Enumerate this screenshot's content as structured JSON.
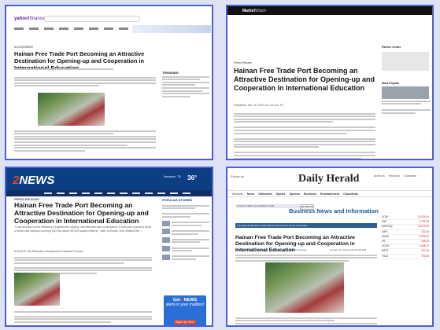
{
  "panel_yahoo": {
    "logo": "yahoo!",
    "logo_suffix": "finance",
    "kicker": "ACCESSWIRE",
    "title": "Hainan Free Trade Port Becoming an Attractive Destination for Opening-up and Cooperation in International Education",
    "trending_heading": "TRENDING"
  },
  "panel_marketwatch": {
    "logo": "Market",
    "logo_suffix": "Watch",
    "kicker": "Press Release",
    "title": "Hainan Free Trade Port Becoming an Attractive Destination for Opening-up and Cooperation in International Education",
    "meta": "Published: Jan. 29, 2021 at 1:43 a.m. ET",
    "side_heading": "Partner Center",
    "side_heading2": "Most Popular"
  },
  "panel_kprc": {
    "logo_num": "2",
    "logo_word": "NEWS",
    "city": "Houston, TX",
    "temp": "36°",
    "kicker": "PRESS RELEASE",
    "title": "Hainan Free Trade Port Becoming an Attractive Destination for Opening-up and Cooperation in International Education",
    "body": "\"I was shocked at the efficiency of agreement signing, site selection and construction. It took just 3 years to build a brand new campus covering 140 mu (about 90,000 square meters),\" said Jo Evans. She recalled the...",
    "source": "SOURCE The Education Department of Hainan Province",
    "popular": "POPULAR STORIES",
    "ad_line1_pre": "Get",
    "ad_line1_num": "2",
    "ad_line1_word": "NEWS",
    "ad_line2": "alerts in your mailbox!",
    "ad_button": "Sign Up Here"
  },
  "panel_dailyherald": {
    "logo": "Daily Herald",
    "top_left": "Follow us",
    "top_right": [
      "Archives",
      "Help/Info",
      "Subscribe"
    ],
    "nav": [
      "Sections",
      "News",
      "Obituaries",
      "Sports",
      "Opinion",
      "Business",
      "Entertainment",
      "Classifieds"
    ],
    "subbar": "TICKER SYMBOL OR COMPANY NAME",
    "getquote": "GET QUOTE",
    "section_title": "Business News and Information",
    "tabs": "The Daily Herald Market Index   Markets   Stock Screen   Funds   Tools   ETFs",
    "title": "Hainan Free Trade Port Becoming an Attractive Destination for Opening-up and Cooperation in International Education",
    "byline": "By: The Education Department of Hainan Province via PR Newswire",
    "date": "January 29, 2021 at 01:32 AM EST",
    "quotes": [
      {
        "name": "DOW",
        "value": "31,024.91",
        "dir": "down"
      },
      {
        "name": "S&P",
        "value": "3,742.63",
        "dir": "down"
      },
      {
        "name": "NASDAQ",
        "value": "13,070.69",
        "dir": "down"
      },
      {
        "name": "AAPL",
        "value": "131.96",
        "dir": "down"
      },
      {
        "name": "AMZN",
        "value": "3,206.20",
        "dir": "down"
      },
      {
        "name": "FB",
        "value": "258.33",
        "dir": "down"
      },
      {
        "name": "GOOG",
        "value": "1,835.74",
        "dir": "down"
      },
      {
        "name": "MSFT",
        "value": "231.96",
        "dir": "down"
      },
      {
        "name": "TSLA",
        "value": "793.53",
        "dir": "down"
      }
    ]
  }
}
